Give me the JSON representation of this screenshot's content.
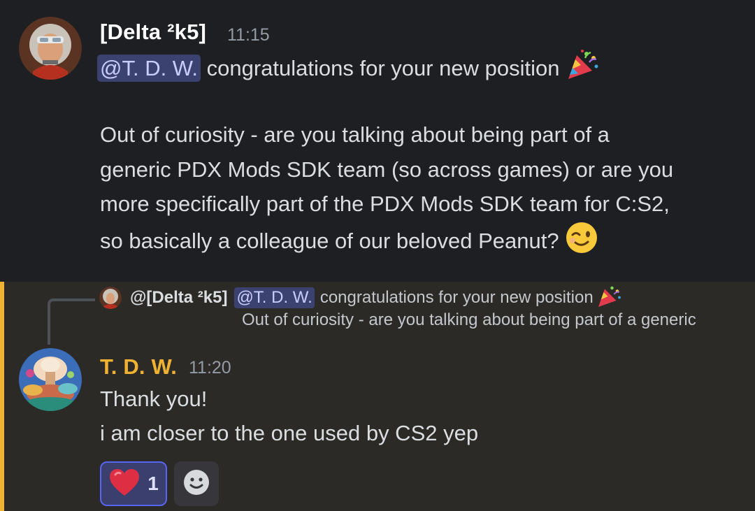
{
  "message1": {
    "author": "[Delta ²k5]",
    "author_color": "#ffffff",
    "timestamp": "11:15",
    "mention": "@T. D. W.",
    "line1_text": "congratulations for your new position",
    "line1_emoji": "party-popper-emoji",
    "lines": [
      "Out of curiosity - are you talking about being part of a",
      "generic PDX Mods SDK team (so across games) or are you",
      "more specifically part of the PDX Mods SDK team for C:S2,",
      "so basically a colleague of our beloved Peanut?"
    ],
    "end_emoji": "winking-face-emoji"
  },
  "reply_preview": {
    "author": "@[Delta ²k5]",
    "mention": "@T. D. W.",
    "text": "congratulations for your new position",
    "line2": "Out of curiosity - are you talking about being part of a generic"
  },
  "message2": {
    "author": "T. D. W.",
    "author_color": "#f0b232",
    "timestamp": "11:20",
    "lines": [
      "Thank you!",
      "i am closer to the one used by CS2 yep"
    ],
    "highlight_color": "#f0b232"
  },
  "reactions": [
    {
      "icon": "heart-icon",
      "count": "1",
      "active": true
    },
    {
      "icon": "add-reaction-icon",
      "count": null,
      "active": false
    }
  ]
}
